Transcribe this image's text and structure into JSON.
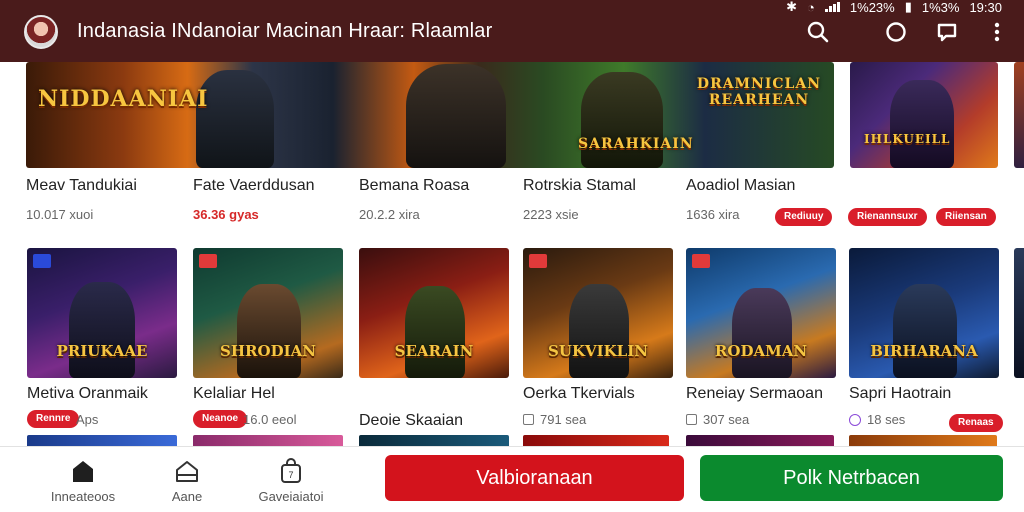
{
  "status_bar": {
    "left_text": "1%23%",
    "middle_text": "1%3%",
    "right_text": "19:30"
  },
  "app_bar": {
    "title": "Indanasia  INdanoiar  Macinan Hraar: Rlaamlar"
  },
  "icons": {
    "avatar": "profile-avatar",
    "search": "search-icon",
    "circle": "circle-icon",
    "chat": "chat-icon",
    "more": "more-vert-icon",
    "home": "home-icon",
    "store": "store-icon",
    "bag": "shopping-bag-icon"
  },
  "featured": [
    {
      "banner_text": "NIDDAANIAI",
      "title": "Meav Tandukiai",
      "meta": "10.017  xuoi",
      "meta_style": "gray"
    },
    {
      "banner_text": "",
      "title": "Fate Vaerddusan",
      "meta": "36.36  gyas",
      "meta_style": "red"
    },
    {
      "banner_text": "",
      "title": "Bemana Roasa",
      "meta": "20.2.2  xira",
      "meta_style": "gray"
    },
    {
      "banner_text": "SARAHKIAIN",
      "title": "Rotrskia Stamal",
      "meta": "2223  xsie",
      "meta_style": "gray"
    },
    {
      "banner_text": "DRAMNICLAN REARHEAN",
      "title": "Aoadiol Masian",
      "meta": "1636  xira",
      "meta_style": "gray",
      "pill": "Rediuuy"
    },
    {
      "banner_text": "IHLKUEILL",
      "title": "",
      "meta": "",
      "pills": [
        "Rienannsuxr",
        "Riiensan"
      ]
    }
  ],
  "grid": [
    {
      "thumb_text": "PRIUKAAE",
      "title": "Metiva Oranmaik",
      "meta": "Aps",
      "pill": "Rennre"
    },
    {
      "thumb_text": "SHRODIAN",
      "title": "Kelaliar Hel",
      "meta": "16.0  eeol",
      "pill": "Neanoe"
    },
    {
      "thumb_text": "SEARAIN",
      "title": "Deoie Skaaian",
      "meta": ""
    },
    {
      "thumb_text": "SUKVIKLIN",
      "title": "Oerka Tkervials",
      "meta": "791  sea"
    },
    {
      "thumb_text": "RODAMAN",
      "title": "Reneiay Sermaoan",
      "meta": "307  sea"
    },
    {
      "thumb_text": "BIRHARANA",
      "title": "Sapri Haotrain",
      "meta": "18  ses",
      "pill": "Renaas"
    }
  ],
  "bottom_nav": [
    {
      "label": "Inneateoos"
    },
    {
      "label": "Aane"
    },
    {
      "label": "Gaveiaiatoi"
    }
  ],
  "actions": {
    "primary_label": "Valbioranaan",
    "secondary_label": "Polk Netrbacen"
  },
  "colors": {
    "app_bar": "#4a1b1b",
    "accent_red": "#d3131c",
    "accent_green": "#0b8a2e",
    "badge_red": "#d91e2a"
  }
}
